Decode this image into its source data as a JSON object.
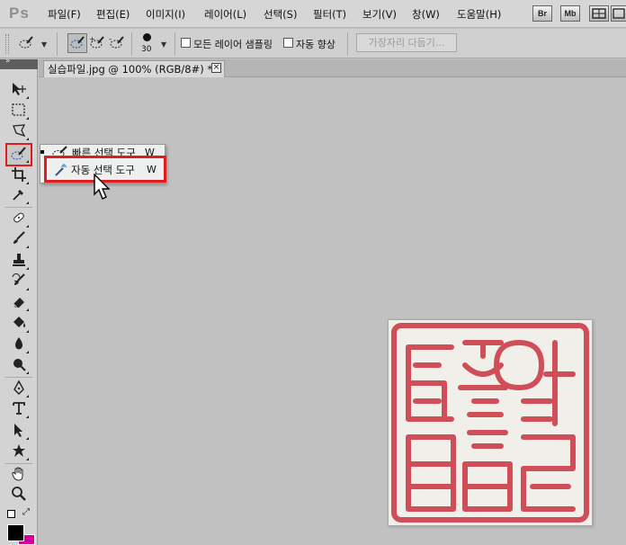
{
  "app": {
    "logo": "Ps"
  },
  "menu": {
    "items": [
      "파일(F)",
      "편집(E)",
      "이미지(I)",
      "레이어(L)",
      "선택(S)",
      "필터(T)",
      "보기(V)",
      "창(W)",
      "도움말(H)"
    ],
    "bridge_icon": "Br",
    "minibridge_icon": "Mb"
  },
  "options": {
    "brush_size": "30",
    "sample_all_layers": "모든 레이어 샘플링",
    "auto_enhance": "자동 향상",
    "refine_edge": "가장자리 다듬기..."
  },
  "document": {
    "tab_title": "실습파일.jpg @ 100% (RGB/8#) *",
    "close_glyph": "×"
  },
  "flyout": {
    "items": [
      {
        "label": "빠른 선택 도구",
        "shortcut": "W",
        "icon": "quick-selection-icon",
        "current": true
      },
      {
        "label": "자동 선택 도구",
        "shortcut": "W",
        "icon": "magic-wand-icon",
        "current": false
      }
    ]
  },
  "tools": [
    "move-icon",
    "marquee-icon",
    "lasso-icon",
    "quick-selection-icon",
    "crop-icon",
    "eyedropper-icon",
    "spot-healing-icon",
    "brush-icon",
    "clone-stamp-icon",
    "history-brush-icon",
    "eraser-icon",
    "paint-bucket-icon",
    "blur-icon",
    "dodge-icon",
    "pen-icon",
    "type-icon",
    "path-selection-icon",
    "shape-icon",
    "hand-icon",
    "zoom-icon"
  ],
  "colors": {
    "foreground": "#000000",
    "background": "#d5009a",
    "highlight": "#e01d1d",
    "seal_ink": "#cf4e58"
  }
}
